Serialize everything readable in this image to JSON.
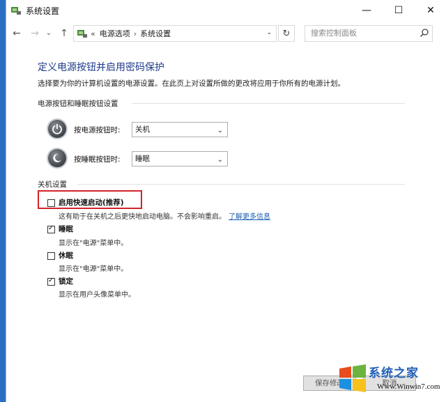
{
  "window": {
    "title": "系统设置",
    "controls": {
      "minimize": "—",
      "maximize": "☐",
      "close": "✕"
    }
  },
  "nav": {
    "back": "←",
    "forward": "→",
    "history": "⌄",
    "up": "↑",
    "overflow": "«",
    "breadcrumb": [
      "电源选项",
      "系统设置"
    ],
    "sep": "›",
    "dropdown": "⌄",
    "refresh": "↻",
    "search_placeholder": "搜索控制面板"
  },
  "page": {
    "title": "定义电源按钮并启用密码保护",
    "description": "选择要为你的计算机设置的电源设置。在此页上对设置所做的更改将应用于你所有的电源计划。"
  },
  "power_buttons": {
    "section_title": "电源按钮和睡眠按钮设置",
    "power_label": "按电源按钮时:",
    "power_value": "关机",
    "sleep_label": "按睡眠按钮时:",
    "sleep_value": "睡眠",
    "chevron": "⌄"
  },
  "shutdown": {
    "section_title": "关机设置",
    "items": [
      {
        "label": "启用快速启动(推荐)",
        "checked": false,
        "desc": "这有助于在关机之后更快地启动电脑。不会影响重启。",
        "link": "了解更多信息"
      },
      {
        "label": "睡眠",
        "checked": true,
        "desc": "显示在\"电源\"菜单中。"
      },
      {
        "label": "休眠",
        "checked": false,
        "desc": "显示在\"电源\"菜单中。"
      },
      {
        "label": "锁定",
        "checked": true,
        "desc": "显示在用户头像菜单中。"
      }
    ]
  },
  "footer": {
    "save": "保存修改",
    "cancel": "取消"
  },
  "watermark": {
    "text": "系统之家",
    "url": "Www.Winwin7.com"
  },
  "colors": {
    "accent": "#1a5fb4",
    "title_blue": "#1e3a8a",
    "highlight": "#d1232a"
  }
}
